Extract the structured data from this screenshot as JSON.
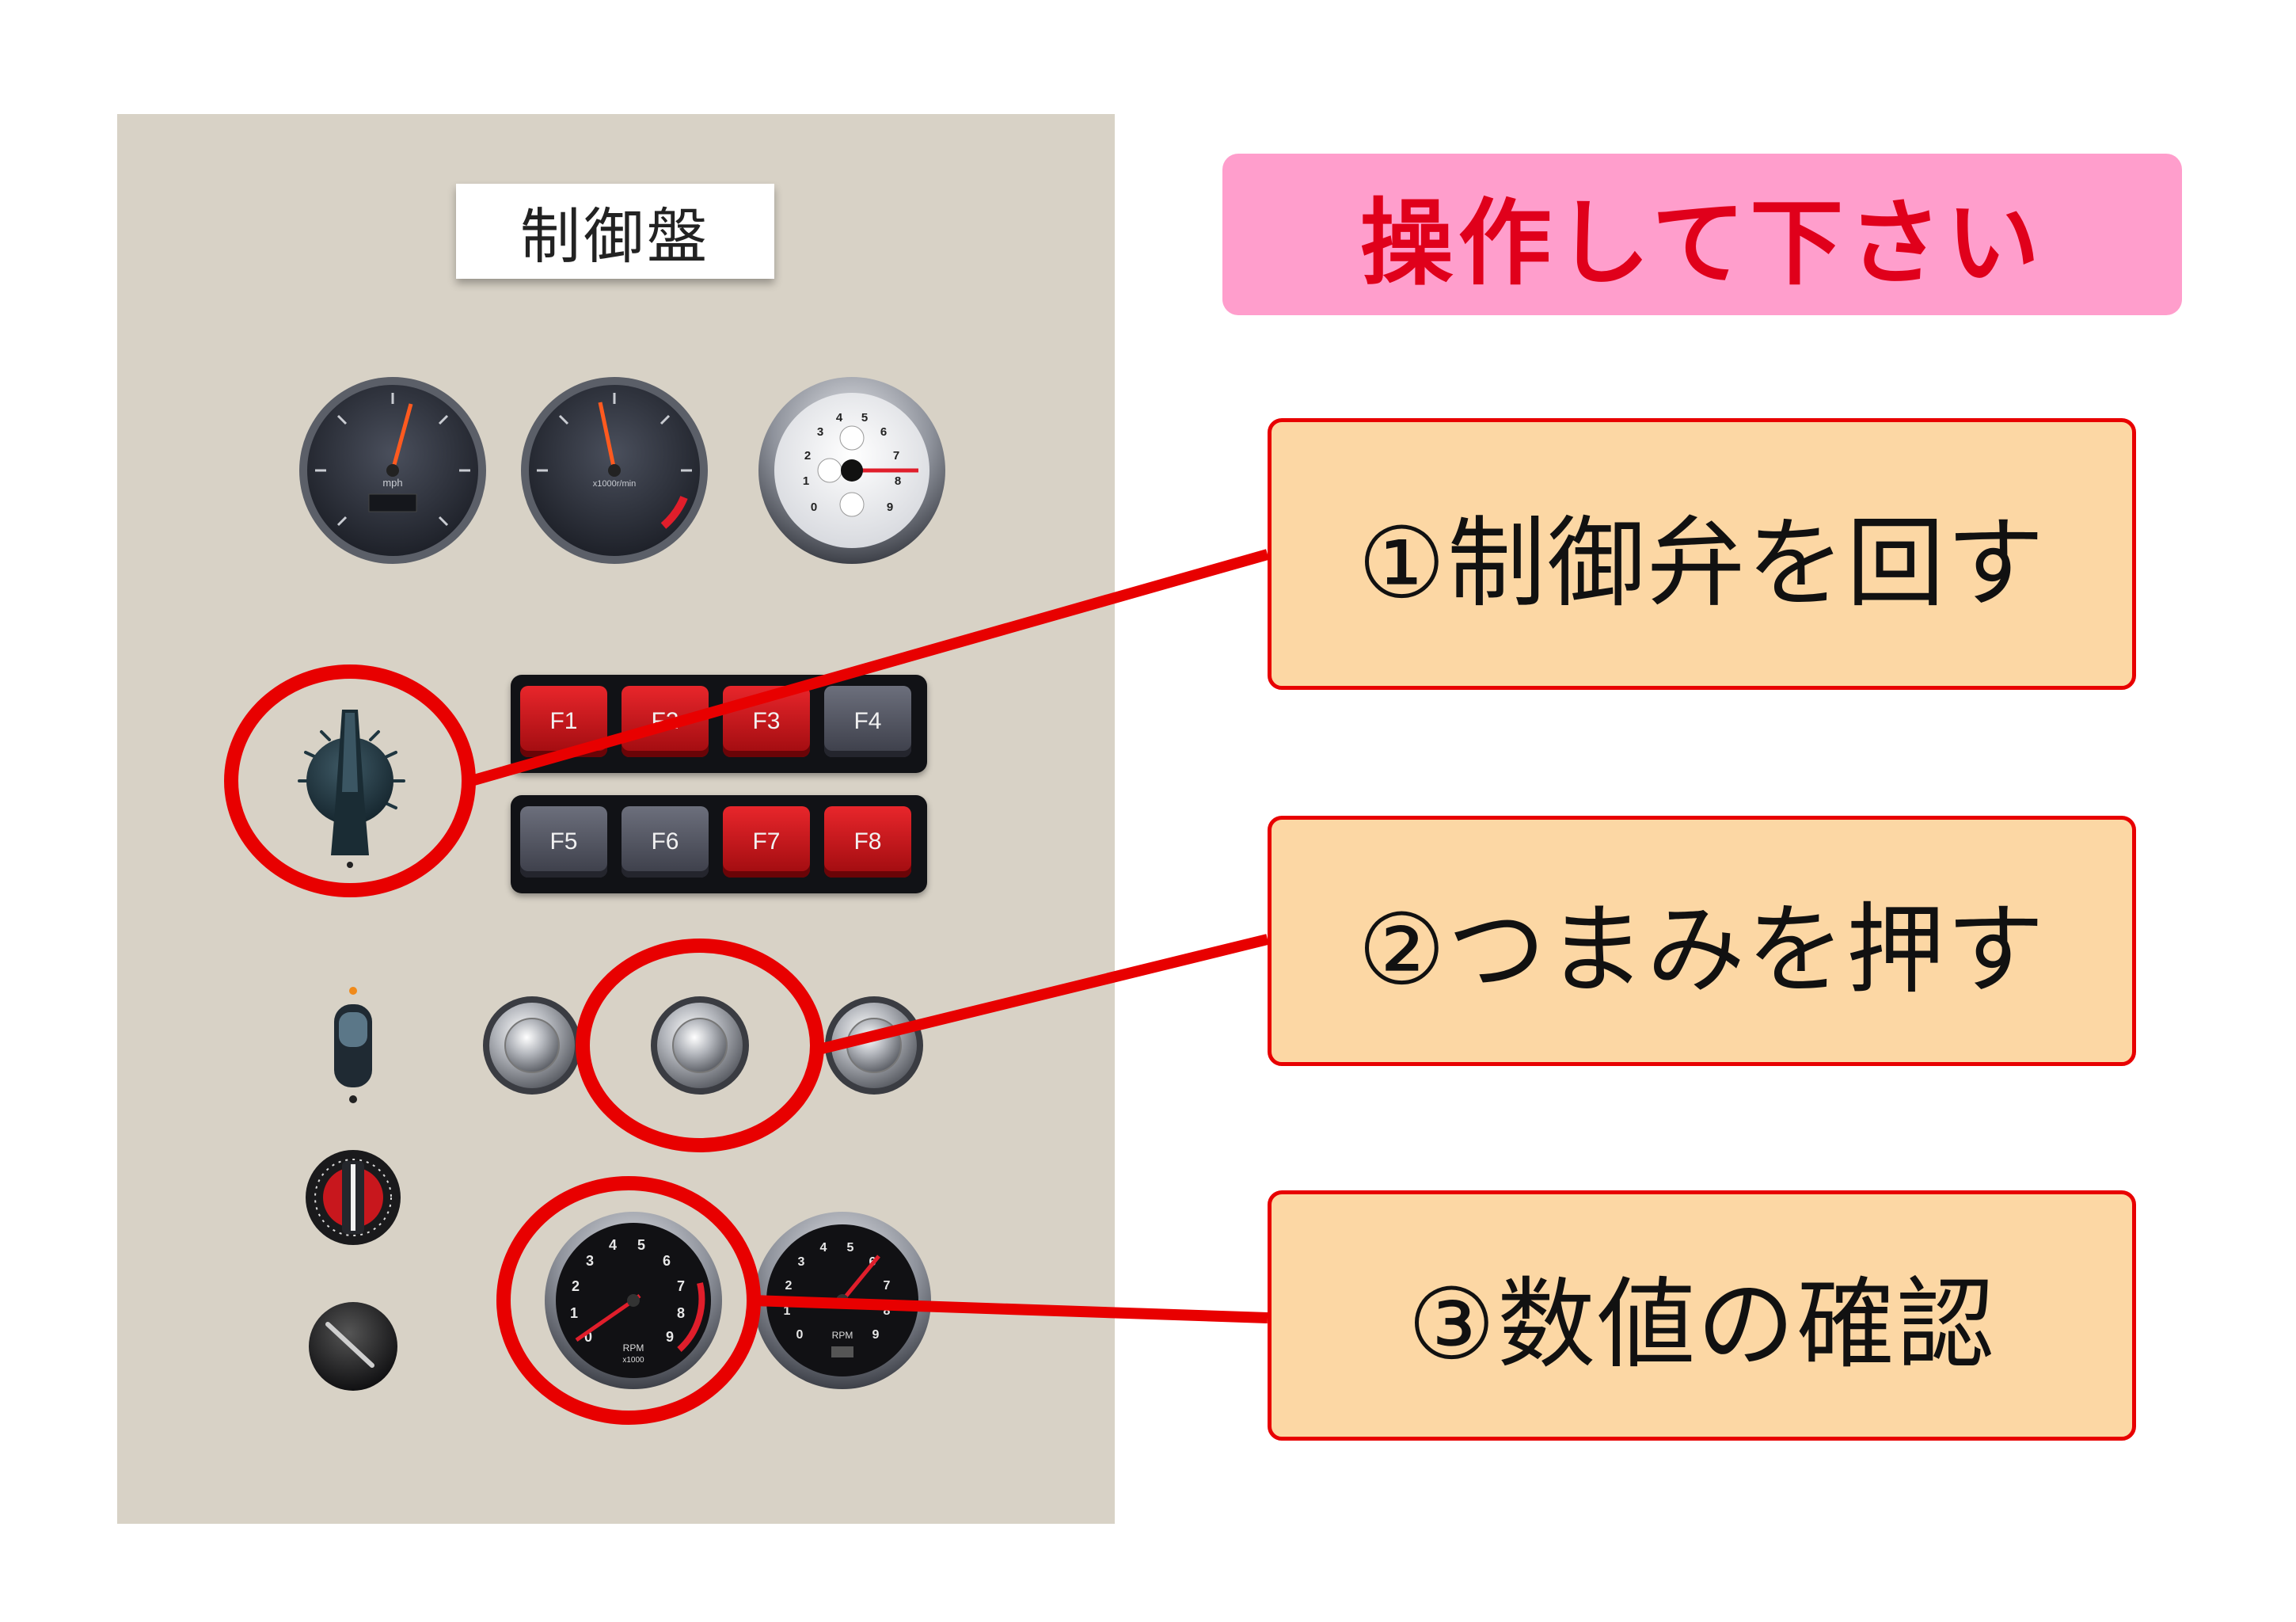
{
  "panel": {
    "title": "制御盤"
  },
  "banner": {
    "text": "操作して下さい"
  },
  "steps": [
    {
      "label": "①制御弁を回す"
    },
    {
      "label": "②つまみを押す"
    },
    {
      "label": "③数値の確認"
    }
  ],
  "gauges": {
    "speedometer": {
      "unit": "mph"
    },
    "tachometer_small": {
      "unit": "x1000r/min"
    },
    "white_gauge": {
      "ticks": [
        "0",
        "1",
        "2",
        "3",
        "4",
        "5",
        "6",
        "7",
        "8",
        "9"
      ]
    },
    "rpm_left": {
      "label": "RPM",
      "sub": "x1000",
      "ticks": [
        "0",
        "1",
        "2",
        "3",
        "4",
        "5",
        "6",
        "7",
        "8",
        "9"
      ]
    },
    "rpm_right": {
      "label": "RPM",
      "ticks": [
        "0",
        "1",
        "2",
        "3",
        "4",
        "5",
        "6",
        "7",
        "8",
        "9"
      ]
    }
  },
  "function_keys": [
    {
      "label": "F1",
      "color": "red"
    },
    {
      "label": "F2",
      "color": "red"
    },
    {
      "label": "F3",
      "color": "red"
    },
    {
      "label": "F4",
      "color": "gray"
    },
    {
      "label": "F5",
      "color": "gray"
    },
    {
      "label": "F6",
      "color": "gray"
    },
    {
      "label": "F7",
      "color": "red"
    },
    {
      "label": "F8",
      "color": "red"
    }
  ],
  "colors": {
    "panel": "#d8d2c6",
    "highlight_red": "#e80000",
    "banner_pink": "#ff9ecc",
    "banner_text": "#e0001b",
    "step_bg": "#fcd7a4"
  }
}
